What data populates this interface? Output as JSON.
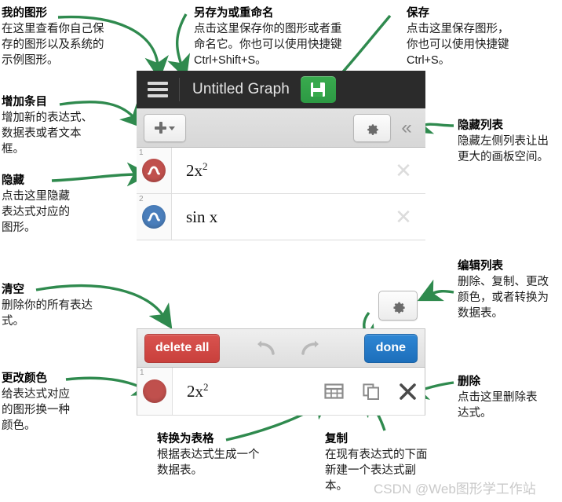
{
  "callouts": [
    {
      "id": "my-graphs",
      "title": "我的图形",
      "body": "在这里查看你自己保\n存的图形以及系统的\n示例图形。"
    },
    {
      "id": "save-as-rename",
      "title": "另存为或重命名",
      "body": "点击这里保存你的图形或者重\n命名它。你也可以使用快捷键\nCtrl+Shift+S。"
    },
    {
      "id": "save",
      "title": "保存",
      "body": "点击这里保存图形，\n你也可以使用快捷键\nCtrl+S。"
    },
    {
      "id": "add-item",
      "title": "增加条目",
      "body": "增加新的表达式、\n数据表或者文本\n框。"
    },
    {
      "id": "hide-list",
      "title": "隐藏列表",
      "body": "隐藏左侧列表让出\n更大的画板空间。"
    },
    {
      "id": "hide",
      "title": "隐藏",
      "body": "点击这里隐藏\n表达式对应的\n图形。"
    },
    {
      "id": "clear-all",
      "title": "清空",
      "body": "删除你的所有表达\n式。"
    },
    {
      "id": "edit-list",
      "title": "编辑列表",
      "body": "删除、复制、更改\n颜色，或者转换为\n数据表。"
    },
    {
      "id": "change-color",
      "title": "更改颜色",
      "body": "给表达式对应\n的图形换一种\n颜色。"
    },
    {
      "id": "delete",
      "title": "删除",
      "body": "点击这里删除表\n达式。"
    },
    {
      "id": "convert-to-table",
      "title": "转换为表格",
      "body": "根据表达式生成一个\n数据表。"
    },
    {
      "id": "duplicate",
      "title": "复制",
      "body": "在现有表达式的下面\n新建一个表达式副\n本。"
    }
  ],
  "panel_top": {
    "topbar": {
      "menu_icon": "hamburger-icon",
      "title": "Untitled Graph",
      "save_icon": "floppy-disk-icon"
    },
    "toolbar": {
      "add_icon": "plus-icon",
      "add_caret_icon": "caret-down-icon",
      "gear_icon": "gear-icon",
      "collapse_icon": "double-chevron-left-icon",
      "collapse_glyph": "«"
    },
    "expressions": [
      {
        "index": "1",
        "color": "#c0504d",
        "latex": "2x²",
        "base": "2x",
        "exp": "2",
        "remove_glyph": "✕"
      },
      {
        "index": "2",
        "color": "#4a7ebb",
        "latex": "sin x",
        "base": "sin x",
        "exp": "",
        "remove_glyph": "✕"
      }
    ]
  },
  "panel_bottom": {
    "gear_icon": "gear-icon",
    "edit_toolbar": {
      "delete_all_label": "delete all",
      "undo_icon": "undo-arrow-icon",
      "undo_glyph": "↰",
      "redo_icon": "redo-arrow-icon",
      "redo_glyph": "↱",
      "done_label": "done"
    },
    "row": {
      "index": "1",
      "color": "#c0504d",
      "base": "2x",
      "exp": "2",
      "table_icon": "table-icon",
      "duplicate_icon": "duplicate-icon",
      "delete_icon": "close-x-icon",
      "delete_glyph": "✕"
    }
  },
  "watermark": "CSDN @Web图形学工作站",
  "colors": {
    "accent_green": "#2d8a45",
    "arrow_green": "#2f8a4e",
    "red": "#c0504d",
    "blue": "#2e86d4",
    "topbar_bg": "#2b2b2b"
  }
}
